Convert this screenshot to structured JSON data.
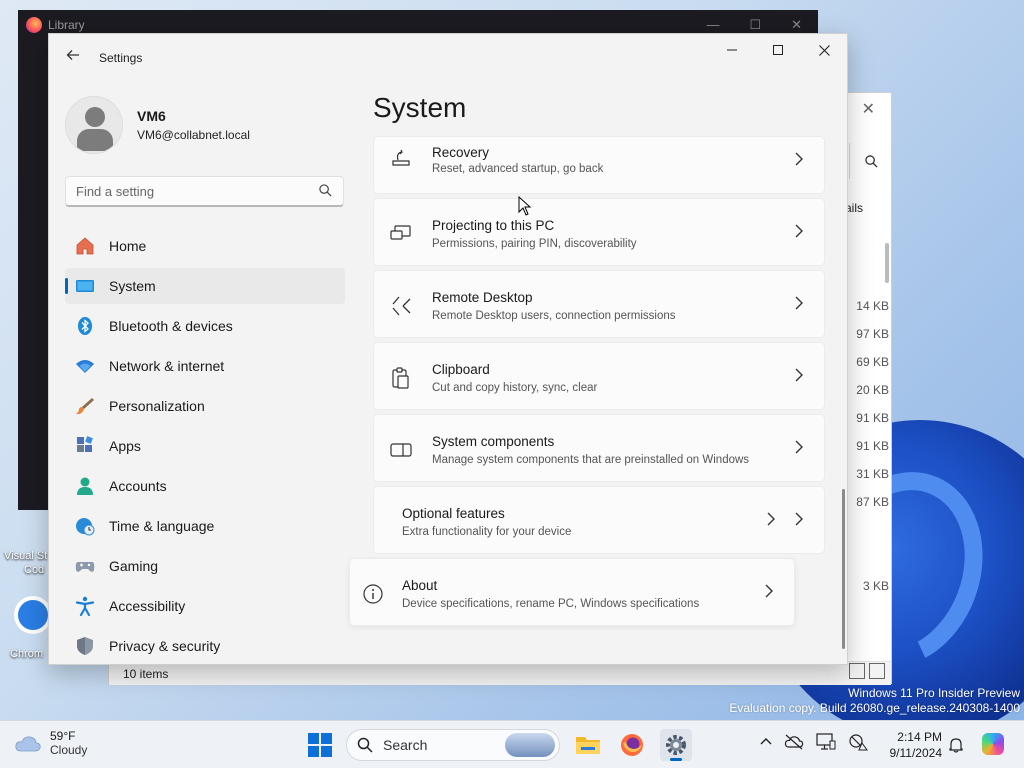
{
  "desktop": {
    "watermark_line1": "Windows 11 Pro Insider Preview",
    "watermark_line2": "Evaluation copy. Build 26080.ge_release.240308-1400",
    "icon_labels": [
      "Visual St",
      "Cod",
      "Chrom"
    ]
  },
  "library_window": {
    "title": "Library"
  },
  "explorer_window": {
    "details_label": "ails",
    "sizes": [
      "14 KB",
      "97 KB",
      "69 KB",
      "20 KB",
      "91 KB",
      "91 KB",
      "31 KB",
      "87 KB",
      "3 KB"
    ],
    "status": "10 items"
  },
  "settings": {
    "app_title": "Settings",
    "user": {
      "name": "VM6",
      "email": "VM6@collabnet.local"
    },
    "search": {
      "placeholder": "Find a setting"
    },
    "nav": [
      {
        "label": "Home",
        "icon": "home-icon"
      },
      {
        "label": "System",
        "icon": "system-icon",
        "active": true
      },
      {
        "label": "Bluetooth & devices",
        "icon": "bluetooth-icon"
      },
      {
        "label": "Network & internet",
        "icon": "wifi-icon"
      },
      {
        "label": "Personalization",
        "icon": "brush-icon"
      },
      {
        "label": "Apps",
        "icon": "apps-icon"
      },
      {
        "label": "Accounts",
        "icon": "person-icon"
      },
      {
        "label": "Time & language",
        "icon": "globe-clock-icon"
      },
      {
        "label": "Gaming",
        "icon": "gamepad-icon"
      },
      {
        "label": "Accessibility",
        "icon": "accessibility-icon"
      },
      {
        "label": "Privacy & security",
        "icon": "shield-icon"
      }
    ],
    "page_title": "System",
    "cards": [
      {
        "title": "Recovery",
        "subtitle": "Reset, advanced startup, go back",
        "icon": "recovery-icon"
      },
      {
        "title": "Projecting to this PC",
        "subtitle": "Permissions, pairing PIN, discoverability",
        "icon": "projecting-icon"
      },
      {
        "title": "Remote Desktop",
        "subtitle": "Remote Desktop users, connection permissions",
        "icon": "remote-desktop-icon"
      },
      {
        "title": "Clipboard",
        "subtitle": "Cut and copy history, sync, clear",
        "icon": "clipboard-icon"
      },
      {
        "title": "System components",
        "subtitle": "Manage system components that are preinstalled on Windows",
        "icon": "system-components-icon"
      },
      {
        "title": "Optional features",
        "subtitle": "Extra functionality for your device",
        "icon": "none"
      },
      {
        "title": "About",
        "subtitle": "Device specifications, rename PC, Windows specifications",
        "icon": "info-icon"
      }
    ]
  },
  "taskbar": {
    "weather_temp": "59°F",
    "weather_condition": "Cloudy",
    "search_label": "Search",
    "time": "2:14 PM",
    "date": "9/11/2024"
  },
  "colors": {
    "accent": "#0067c0"
  }
}
